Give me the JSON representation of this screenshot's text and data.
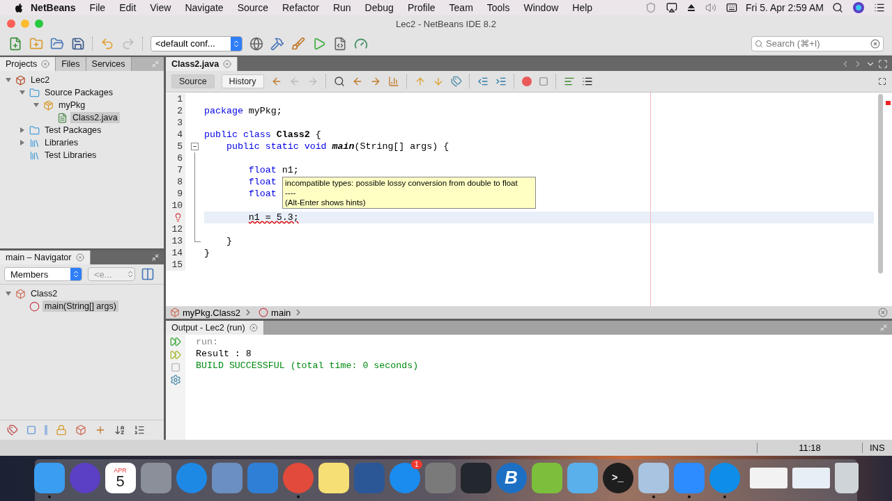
{
  "menubar": {
    "app": "NetBeans",
    "menus": [
      "File",
      "Edit",
      "View",
      "Navigate",
      "Source",
      "Refactor",
      "Run",
      "Debug",
      "Profile",
      "Team",
      "Tools",
      "Window",
      "Help"
    ],
    "clock": "Fri 5. Apr  2:59 AM"
  },
  "window": {
    "title": "Lec2 - NetBeans IDE 8.2"
  },
  "toolbar": {
    "config": "<default conf...",
    "search": {
      "placeholder": "Search (⌘+I)"
    }
  },
  "projects_panel": {
    "tabs": [
      {
        "label": "Projects",
        "selected": true
      },
      {
        "label": "Files",
        "selected": false
      },
      {
        "label": "Services",
        "selected": false
      }
    ],
    "tree": [
      {
        "label": "Lec2",
        "kind": "project",
        "expanded": true,
        "selected": false,
        "children": [
          {
            "label": "Source Packages",
            "kind": "source-folder",
            "expanded": true,
            "selected": false,
            "children": [
              {
                "label": "myPkg",
                "kind": "package",
                "expanded": true,
                "selected": false,
                "children": [
                  {
                    "label": "Class2.java",
                    "kind": "java-file",
                    "selected": true
                  }
                ]
              }
            ]
          },
          {
            "label": "Test Packages",
            "kind": "source-folder",
            "expanded": false,
            "selected": false
          },
          {
            "label": "Libraries",
            "kind": "library",
            "expanded": false,
            "selected": false
          },
          {
            "label": "Test Libraries",
            "kind": "library",
            "selected": false
          }
        ]
      }
    ]
  },
  "navigator": {
    "tab": {
      "label": "main – Navigator",
      "selected": true
    },
    "filter": "Members",
    "scope": "<e...",
    "tree": [
      {
        "label": "Class2",
        "kind": "class",
        "expanded": true,
        "selected": false,
        "children": [
          {
            "label": "main(String[] args)",
            "kind": "method",
            "selected": true
          }
        ]
      }
    ]
  },
  "editor": {
    "tabs": [
      {
        "label": "Class2.java",
        "selected": true
      }
    ],
    "views": [
      {
        "label": "Source",
        "selected": true
      },
      {
        "label": "History",
        "selected": false
      }
    ],
    "lines": [
      {
        "number": "1",
        "kind": "plain",
        "current": false,
        "error": false
      },
      {
        "number": "2",
        "kind": "plain",
        "current": false,
        "error": false,
        "tokens": [
          {
            "text": "package",
            "kind": "keyword"
          },
          {
            "text": " myPkg;",
            "kind": "plain"
          }
        ]
      },
      {
        "number": "3",
        "kind": "plain",
        "current": false,
        "error": false
      },
      {
        "number": "4",
        "kind": "plain",
        "current": false,
        "error": false,
        "tokens": [
          {
            "text": "public",
            "kind": "keyword"
          },
          {
            "text": " class",
            "kind": "keyword"
          },
          {
            "text": " Class2",
            "kind": "bold"
          },
          {
            "text": " {",
            "kind": "plain"
          }
        ]
      },
      {
        "number": "5",
        "kind": "fold-start",
        "current": false,
        "error": false,
        "tokens": [
          {
            "text": "    public",
            "kind": "keyword"
          },
          {
            "text": " static",
            "kind": "keyword"
          },
          {
            "text": " void",
            "kind": "keyword"
          },
          {
            "text": " main",
            "kind": "bold-italic"
          },
          {
            "text": "(String[] args) {",
            "kind": "plain"
          }
        ]
      },
      {
        "number": "6",
        "kind": "fold-body",
        "current": false,
        "error": false
      },
      {
        "number": "7",
        "kind": "fold-body",
        "current": false,
        "error": false,
        "tokens": [
          {
            "text": "        float",
            "kind": "keyword"
          },
          {
            "text": " n1;",
            "kind": "plain"
          }
        ]
      },
      {
        "number": "8",
        "kind": "fold-body",
        "current": false,
        "error": false,
        "tokens": [
          {
            "text": "        float",
            "kind": "keyword"
          }
        ]
      },
      {
        "number": "9",
        "kind": "fold-body",
        "current": false,
        "error": false,
        "tokens": [
          {
            "text": "        float",
            "kind": "keyword"
          }
        ]
      },
      {
        "number": "10",
        "kind": "fold-body",
        "current": false,
        "error": false
      },
      {
        "kind": "fold-body",
        "current": true,
        "error": true,
        "tokens": [
          {
            "text": "        n1 = 5.3;",
            "kind": "error"
          }
        ]
      },
      {
        "number": "12",
        "kind": "fold-body",
        "current": false,
        "error": false
      },
      {
        "number": "13",
        "kind": "fold-end",
        "current": false,
        "error": false,
        "tokens": [
          {
            "text": "    }",
            "kind": "plain"
          }
        ]
      },
      {
        "number": "14",
        "kind": "plain",
        "current": false,
        "error": false,
        "tokens": [
          {
            "text": "}",
            "kind": "plain"
          }
        ]
      },
      {
        "number": "15",
        "kind": "plain",
        "current": false,
        "error": false
      }
    ],
    "tooltip": {
      "lines": [
        "incompatible types: possible lossy conversion from double to float",
        "----",
        "(Alt-Enter shows hints)"
      ]
    },
    "breadcrumb": [
      {
        "label": "myPkg.Class2",
        "kind": "class"
      },
      {
        "label": "main",
        "kind": "method"
      }
    ]
  },
  "output": {
    "tab": {
      "label": "Output - Lec2 (run)",
      "selected": true
    },
    "lines": [
      {
        "text": "run:",
        "kind": "info"
      },
      {
        "text": "Result : 8",
        "kind": "plain"
      },
      {
        "text": "BUILD SUCCESSFUL (total time: 0 seconds)",
        "kind": "success"
      }
    ]
  },
  "status_bar": {
    "position": "11:18",
    "mode": "INS"
  },
  "dock": {
    "items": [
      {
        "kind": "app",
        "color": "#3a9df0",
        "running": true
      },
      {
        "kind": "app",
        "color": "#5b3fc4",
        "running": false
      },
      {
        "kind": "calendar",
        "color": "#ffffff",
        "running": false,
        "month": "APR",
        "day": "5"
      },
      {
        "kind": "app",
        "color": "#8a8f99",
        "running": false
      },
      {
        "kind": "app",
        "color": "#1e88e5",
        "running": false
      },
      {
        "kind": "app",
        "color": "#6b8fc0",
        "running": false
      },
      {
        "kind": "app",
        "color": "#2f7fd6",
        "running": false
      },
      {
        "kind": "app",
        "color": "#e24a3b",
        "running": true
      },
      {
        "kind": "app",
        "color": "#f6df74",
        "running": false
      },
      {
        "kind": "app",
        "color": "#2b5797",
        "running": false
      },
      {
        "kind": "app",
        "color": "#1a8cf0",
        "running": false,
        "badge": "1"
      },
      {
        "kind": "app",
        "color": "#7a7a7a",
        "running": false
      },
      {
        "kind": "app",
        "color": "#23272e",
        "running": false
      },
      {
        "kind": "app",
        "color": "#1d6fc4",
        "running": false,
        "glyph": "B"
      },
      {
        "kind": "app",
        "color": "#7cbf3c",
        "running": false
      },
      {
        "kind": "app",
        "color": "#5ab0ea",
        "running": false
      },
      {
        "kind": "app",
        "color": "#1e1e1e",
        "running": false,
        "glyph": ">_"
      },
      {
        "kind": "app",
        "color": "#a8c4e0",
        "running": true
      },
      {
        "kind": "app",
        "color": "#2d8cff",
        "running": true
      },
      {
        "kind": "app",
        "color": "#0e8ee9",
        "running": true
      },
      {
        "kind": "thumbnail",
        "color": "#f2f2f2",
        "running": false
      },
      {
        "kind": "thumbnail",
        "color": "#e8eef6",
        "running": false
      },
      {
        "kind": "trash",
        "color": "#cfd4d8",
        "running": false
      }
    ]
  }
}
